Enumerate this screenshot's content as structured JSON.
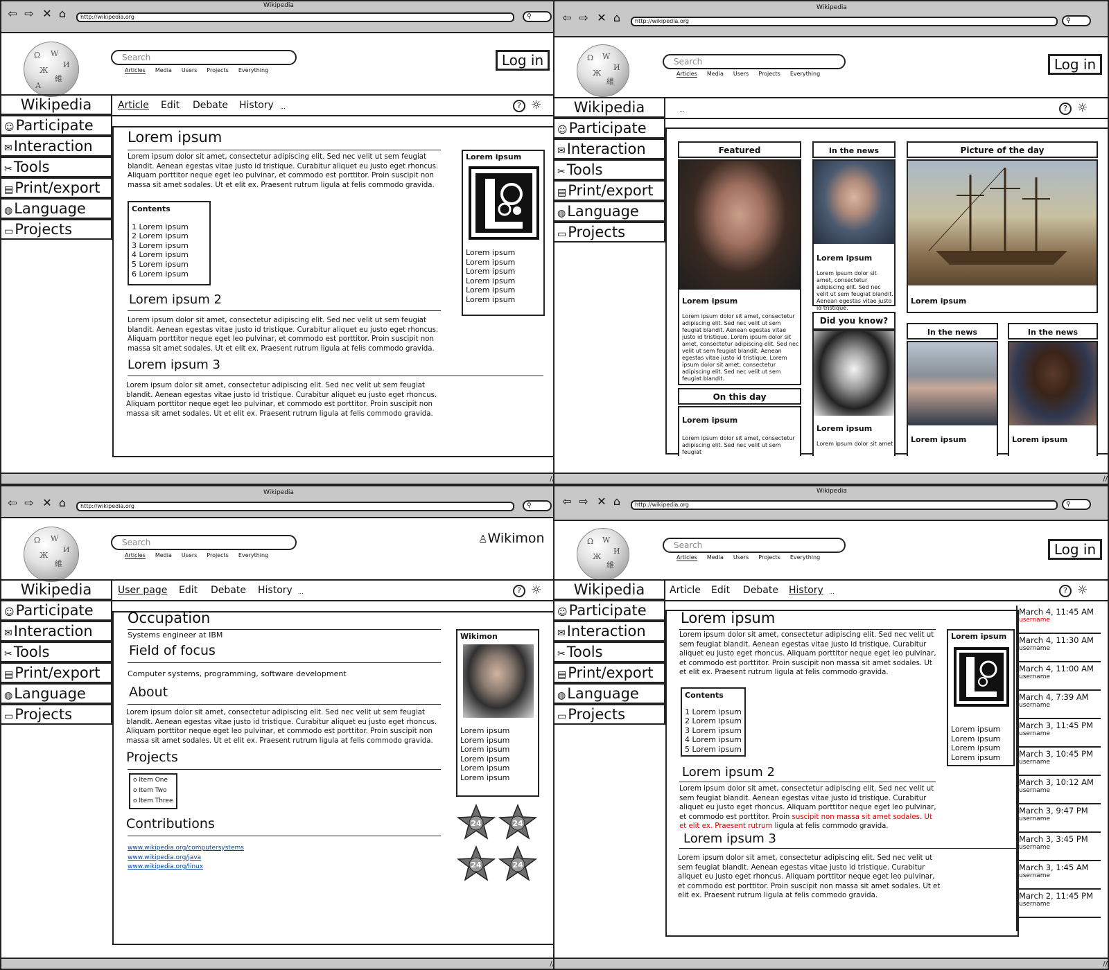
{
  "browser": {
    "window_title": "Wikipedia",
    "url": "http://wikipedia.org",
    "icons": [
      "back-icon",
      "forward-icon",
      "close-icon",
      "home-icon",
      "search-icon"
    ]
  },
  "header": {
    "search_placeholder": "Search",
    "search_tabs": [
      "Articles",
      "Media",
      "Users",
      "Projects",
      "Everything"
    ],
    "login": "Log in",
    "username": "Wikimon"
  },
  "sidebar": {
    "title": "Wikipedia",
    "items": [
      "Participate",
      "Interaction",
      "Tools",
      "Print/export",
      "Language",
      "Projects"
    ]
  },
  "tabs": {
    "article": "Article",
    "user_page": "User page",
    "edit": "Edit",
    "debate": "Debate",
    "history": "History",
    "more": "...",
    "help": "?",
    "settings": "☼"
  },
  "article": {
    "title": "Lorem ipsum",
    "title2": "Lorem ipsum 2",
    "title3": "Lorem ipsum 3",
    "para": "Lorem ipsum dolor sit amet, consectetur adipiscing elit. Sed nec velit ut sem feugiat blandit. Aenean egestas vitae justo id tristique. Curabitur aliquet eu justo eget rhoncus. Aliquam porttitor neque eget leo pulvinar, et commodo est porttitor. Proin suscipit non massa sit amet sodales. Ut et elit ex. Praesent rutrum ligula at felis commodo gravida.",
    "para_a": "Lorem ipsum dolor sit amet, consectetur adipiscing elit. Sed nec velit ut sem feugiat blandit. Aenean egestas vitae justo id tristique. Curabitur aliquet eu justo eget rhoncus. Aliquam porttitor neque eget leo pulvinar, et commodo est porttitor. Proin",
    "para_red": "suscipit non massa sit amet sodales. Ut et elit ex. Praesent rutrum",
    "para_b": "ligula at felis commodo gravida.",
    "contents_title": "Contents",
    "contents": [
      "1 Lorem ipsum",
      "2 Lorem ipsum",
      "3 Lorem ipsum",
      "4 Lorem ipsum",
      "5 Lorem ipsum",
      "6 Lorem ipsum"
    ],
    "infobox_title": "Lorem ipsum",
    "infobox_rows": [
      "Lorem ipsum",
      "Lorem ipsum",
      "Lorem ipsum",
      "Lorem ipsum",
      "Lorem ipsum",
      "Lorem ipsum"
    ]
  },
  "main_page": {
    "featured": "Featured",
    "in_the_news": "In the news",
    "picture_of_the_day": "Picture of the day",
    "did_you_know": "Did you know?",
    "on_this_day": "On this day",
    "lorem": "Lorem ipsum",
    "featured_text": "Lorem ipsum dolor sit amet, consectetur adipiscing elit. Sed nec velit ut sem feugiat blandit. Aenean egestas vitae justo id tristique. Lorem ipsum dolor sit amet, consectetur adipiscing elit. Sed nec velit ut sem feugiat blandit. Aenean egestas vitae justo id tristique. Lorem ipsum dolor sit amet, consectetur adipiscing elit. Sed nec velit ut sem feugiat blandit.",
    "news_text": "Lorem ipsum dolor sit amet, consectetur adipiscing elit. Sed nec velit ut sem feugiat blandit. Aenean egestas vitae justo id tristique.",
    "otd_text": "Lorem ipsum dolor sit amet, consectetur adipiscing elit. Sed nec velit ut sem feugiat",
    "dyk_text": "Lorem ipsum dolor sit amet"
  },
  "user_page": {
    "occupation": "Occupation",
    "occupation_value": "Systems engineer at IBM",
    "field": "Field of focus",
    "field_value": "Computer systems, programming, software development",
    "about": "About",
    "projects": "Projects",
    "project_items": [
      "o Item One",
      "o Item Two",
      "o Item Three"
    ],
    "contributions": "Contributions",
    "links": [
      "www.wikipedia.org/computersystems",
      "www.wikipedia.org/java",
      "www.wikipedia.org/linux"
    ],
    "badge": "24"
  },
  "history": {
    "username": "username",
    "entries": [
      {
        "date": "March 4, 11:45 AM",
        "highlight": true
      },
      {
        "date": "March 4, 11:30 AM",
        "highlight": false
      },
      {
        "date": "March 4, 11:00 AM",
        "highlight": false
      },
      {
        "date": "March 4, 7:39 AM",
        "highlight": false
      },
      {
        "date": "March 3, 11:45 PM",
        "highlight": false
      },
      {
        "date": "March 3, 10:45 PM",
        "highlight": false
      },
      {
        "date": "March 3, 10:12 AM",
        "highlight": false
      },
      {
        "date": "March 3, 9:47 PM",
        "highlight": false
      },
      {
        "date": "March 3, 3:45 PM",
        "highlight": false
      },
      {
        "date": "March 3, 1:45 AM",
        "highlight": false
      },
      {
        "date": "March 2, 11:45 PM",
        "highlight": false
      }
    ],
    "highlight_color": "#e00000"
  }
}
